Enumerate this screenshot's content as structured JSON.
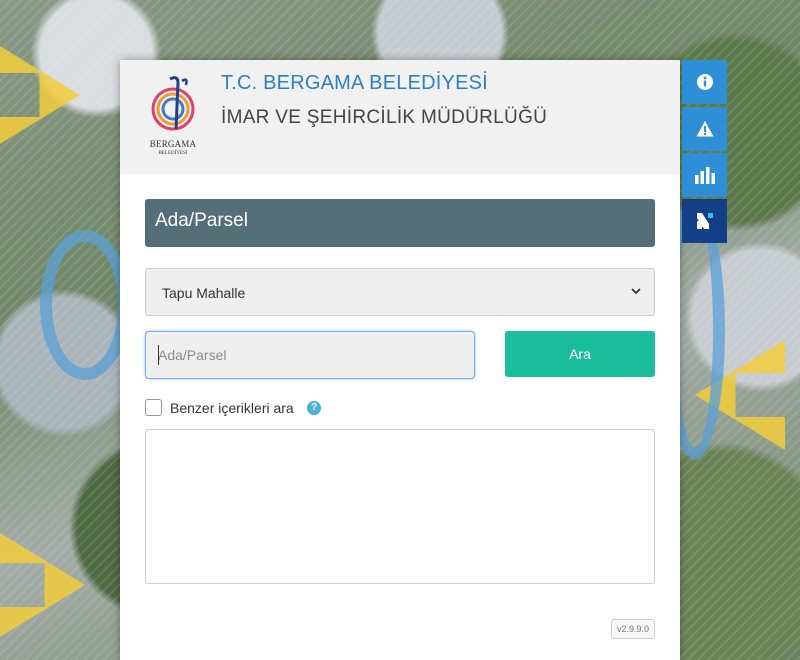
{
  "header": {
    "org_title": "T.C. BERGAMA BELEDİYESİ",
    "dept_title": "İMAR VE ŞEHİRCİLİK MÜDÜRLÜĞÜ",
    "logo_word": "BERGAMA",
    "logo_sub": "BELEDİYESİ"
  },
  "panel": {
    "section_title": "Ada/Parsel",
    "district_select": {
      "selected": "Tapu Mahalle"
    },
    "search_input": {
      "placeholder": "Ada/Parsel",
      "value": ""
    },
    "search_button": "Ara",
    "similar_checkbox": {
      "label": "Benzer içerikleri ara",
      "checked": false
    },
    "help_glyph": "?",
    "version": "v2.9.9.0"
  },
  "side_toolbar": [
    {
      "icon": "info-icon"
    },
    {
      "icon": "warning-icon"
    },
    {
      "icon": "bar-chart-icon"
    },
    {
      "icon": "netcad-logo-icon"
    }
  ],
  "colors": {
    "accent_blue": "#2f8fd6",
    "section_bar": "#546e7a",
    "search_button": "#1bbc9b",
    "title_blue": "#2c7fc1"
  }
}
